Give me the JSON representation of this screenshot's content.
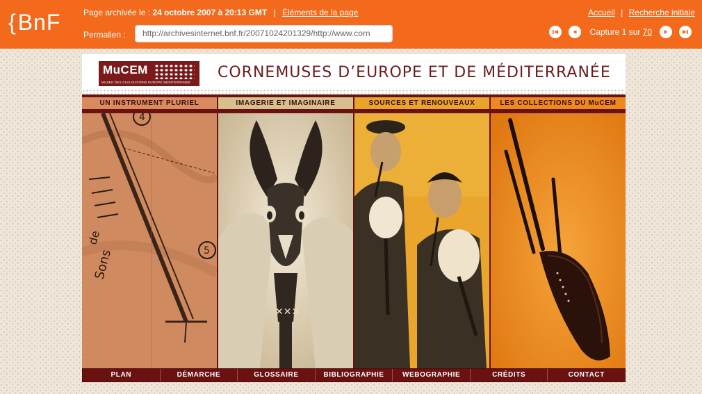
{
  "archive_bar": {
    "logo": "BnF",
    "archived_label": "Page archivée le :",
    "archived_date": "24 octobre 2007 à 20:13 GMT",
    "separator": "|",
    "elements_link": "Éléments de la page",
    "permalink_label": "Permalien :",
    "permalink_value": "http://archivesinternet.bnf.fr/20071024201329/http://www.corn",
    "home_link": "Accueil",
    "initial_search_link": "Recherche initiale",
    "capture_prefix": "Capture 1 sur",
    "capture_total": "70",
    "colors": {
      "bar": "#f36a1d",
      "text": "#ffffff"
    },
    "nav_icons": [
      "first-capture-icon",
      "previous-capture-icon",
      "next-capture-icon",
      "last-capture-icon"
    ]
  },
  "site": {
    "logo_name": "MuCEM",
    "logo_subtitle": "MUSEE DES CIVILISATIONS EUROPE MEDITERRANEE",
    "title": "CORNEMUSES D’EUROPE ET DE MÉDITERRANÉE",
    "panels": [
      {
        "label": "UN INSTRUMENT PLURIEL",
        "color": "#d98a5e",
        "image_text": [
          "Sons",
          "de",
          "4",
          "5"
        ]
      },
      {
        "label": "IMAGERIE ET IMAGINAIRE",
        "color": "#d7c08e"
      },
      {
        "label": "SOURCES ET RENOUVEAUX",
        "color": "#e8a52a"
      },
      {
        "label": "LES COLLECTIONS DU MuCEM",
        "color": "#ee8a1d"
      }
    ],
    "menu": [
      "PLAN",
      "DÉMARCHE",
      "GLOSSAIRE",
      "BIBLIOGRAPHIE",
      "WEBOGRAPHIE",
      "CRÉDITS",
      "CONTACT"
    ],
    "colors": {
      "title": "#6a1b1b",
      "frame": "#6a1212"
    }
  }
}
